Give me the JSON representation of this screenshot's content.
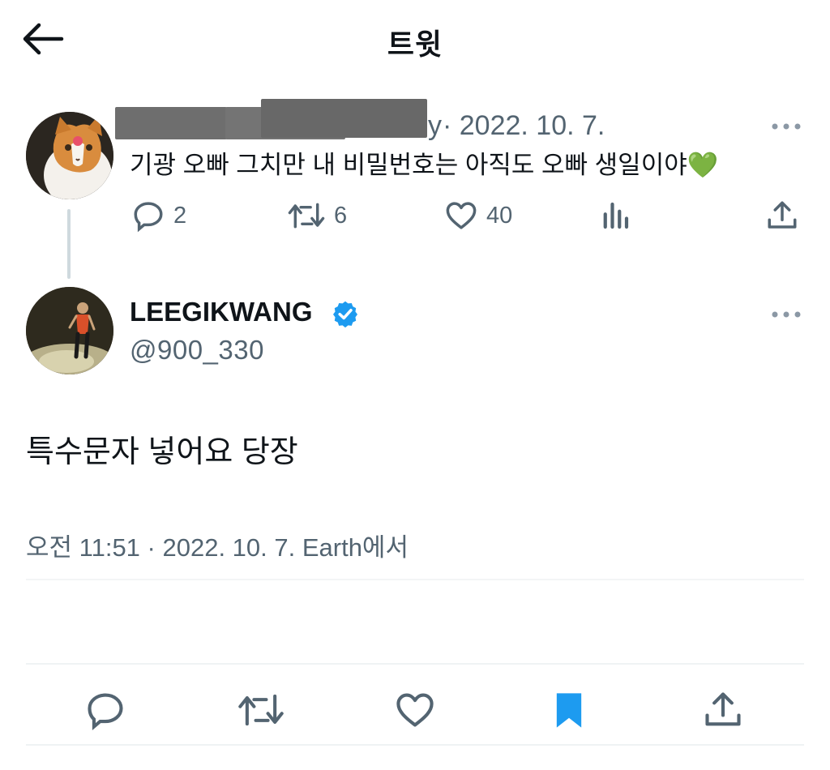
{
  "header": {
    "title": "트윗"
  },
  "reply_tweet": {
    "visible_handle_fragment": "y",
    "date": "· 2022. 10. 7.",
    "text": "기광 오빠 그치만 내 비밀번호는 아직도 오빠 생일이야💚",
    "stats": {
      "replies": "2",
      "retweets": "6",
      "likes": "40"
    }
  },
  "main_tweet": {
    "display_name": "LEEGIKWANG",
    "handle": "@900_330",
    "text": "특수문자 넣어요 당장",
    "meta": "오전 11:51 · 2022. 10. 7. Earth에서"
  },
  "colors": {
    "text": "#0f1419",
    "secondary": "#536471",
    "verified": "#1d9bf0",
    "bookmark_active": "#1d9bf0",
    "divider": "#eff3f4"
  },
  "icons": [
    "back-arrow-icon",
    "more-icon",
    "reply-icon",
    "retweet-icon",
    "like-icon",
    "analytics-icon",
    "share-icon",
    "verified-badge-icon",
    "bookmark-icon"
  ]
}
